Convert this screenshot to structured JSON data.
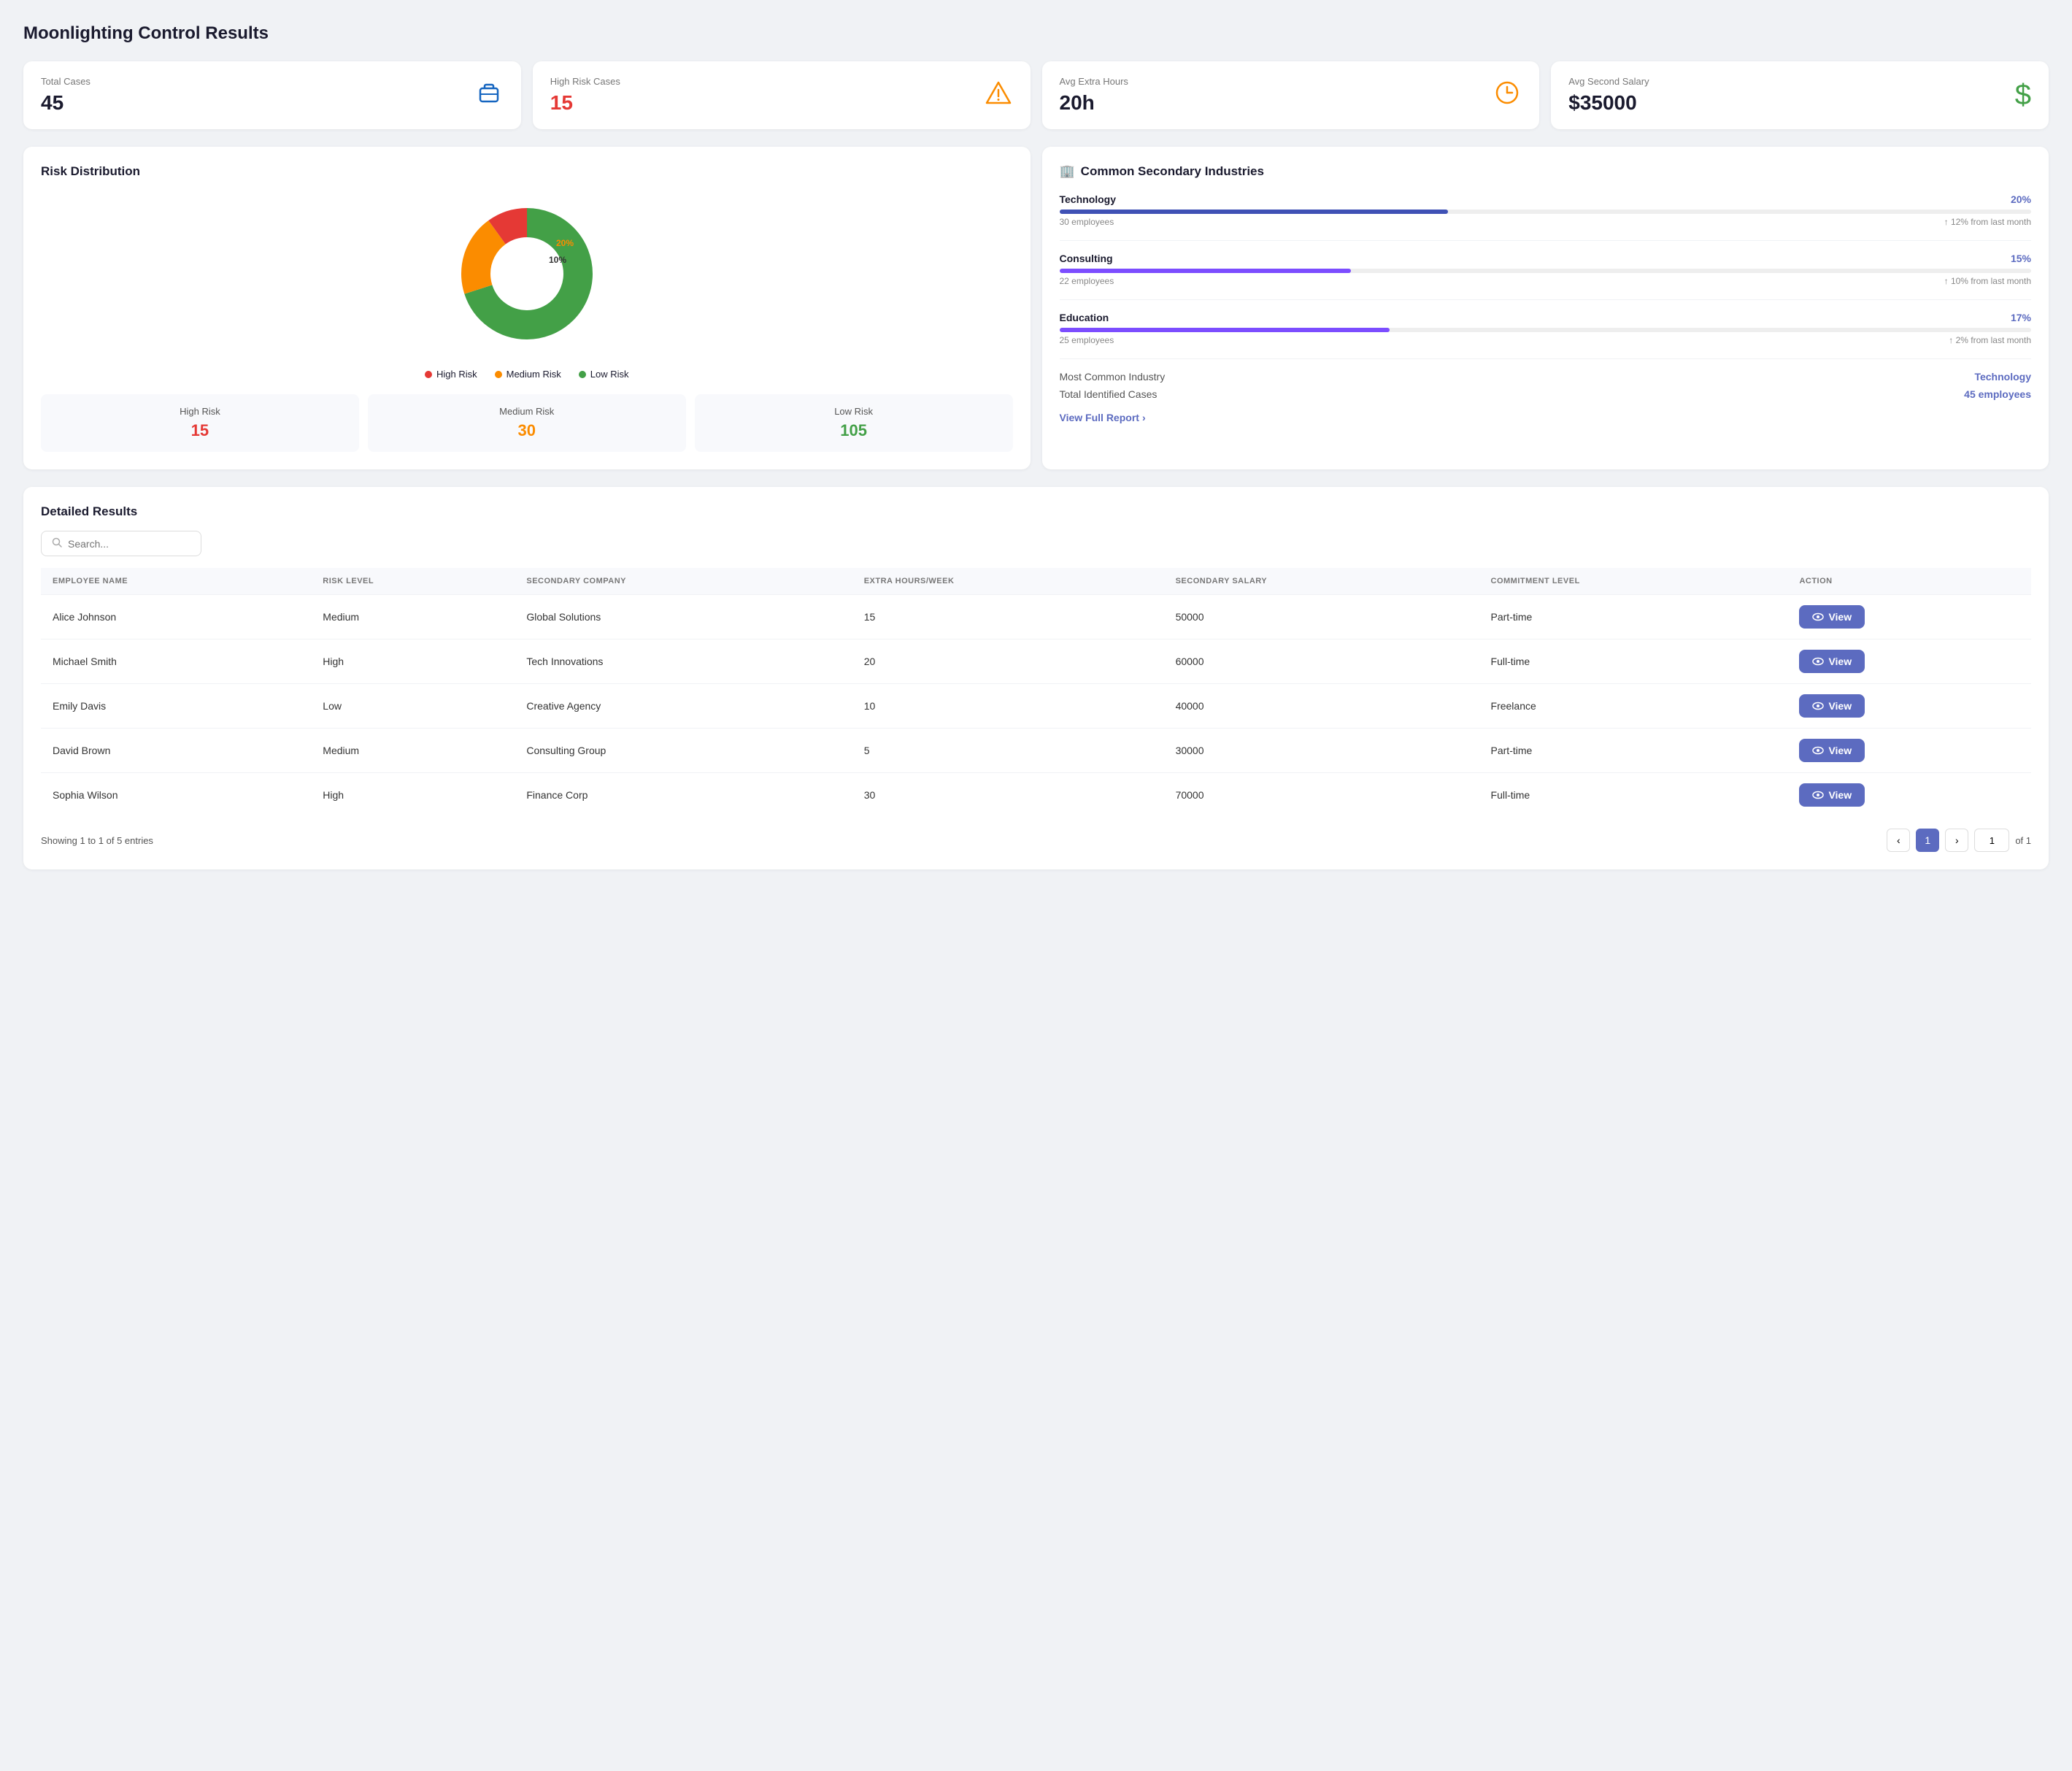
{
  "page": {
    "title": "Moonlighting Control Results"
  },
  "stats": [
    {
      "id": "total-cases",
      "label": "Total Cases",
      "value": "45",
      "value_color": "normal",
      "icon": "💼",
      "icon_color": "#1565c0"
    },
    {
      "id": "high-risk",
      "label": "High Risk Cases",
      "value": "15",
      "value_color": "red",
      "icon": "⚠️",
      "icon_color": "#fb8c00"
    },
    {
      "id": "avg-hours",
      "label": "Avg Extra Hours",
      "value": "20h",
      "value_color": "normal",
      "icon": "🕐",
      "icon_color": "#fb8c00"
    },
    {
      "id": "avg-salary",
      "label": "Avg Second Salary",
      "value": "$35000",
      "value_color": "normal",
      "icon": "$",
      "icon_color": "#43a047"
    }
  ],
  "risk_distribution": {
    "title": "Risk Distribution",
    "segments": [
      {
        "label": "High Risk",
        "pct": 10,
        "color": "#e53935",
        "start": 0
      },
      {
        "label": "Medium Risk",
        "pct": 20,
        "color": "#fb8c00",
        "start": 10
      },
      {
        "label": "Low Risk",
        "pct": 70,
        "color": "#43a047",
        "start": 30
      }
    ],
    "labels": {
      "high_risk": "High Risk",
      "medium_risk": "Medium Risk",
      "low_risk": "Low Risk"
    },
    "stats": [
      {
        "label": "High Risk",
        "value": "15",
        "color_class": "red"
      },
      {
        "label": "Medium Risk",
        "value": "30",
        "color_class": "orange"
      },
      {
        "label": "Low Risk",
        "value": "105",
        "color_class": "green"
      }
    ]
  },
  "industries": {
    "title": "Common Secondary Industries",
    "icon": "🏢",
    "items": [
      {
        "name": "Technology",
        "pct": "20%",
        "pct_num": 20,
        "bar_color": "#3f51b5",
        "employees": "30 employees",
        "trend": "↑ 12% from last month"
      },
      {
        "name": "Consulting",
        "pct": "15%",
        "pct_num": 15,
        "bar_color": "#7c4dff",
        "employees": "22 employees",
        "trend": "↑ 10% from last month"
      },
      {
        "name": "Education",
        "pct": "17%",
        "pct_num": 17,
        "bar_color": "#7c4dff",
        "employees": "25 employees",
        "trend": "↑ 2% from last month"
      }
    ],
    "summary": [
      {
        "label": "Most Common Industry",
        "value": "Technology"
      },
      {
        "label": "Total Identified Cases",
        "value": "45 employees"
      }
    ],
    "view_full_report": "View Full Report"
  },
  "detailed": {
    "title": "Detailed Results",
    "search_placeholder": "Search...",
    "columns": [
      "EMPLOYEE NAME",
      "RISK LEVEL",
      "SECONDARY COMPANY",
      "EXTRA HOURS/WEEK",
      "SECONDARY SALARY",
      "COMMITMENT LEVEL",
      "ACTION"
    ],
    "rows": [
      {
        "name": "Alice Johnson",
        "risk": "Medium",
        "company": "Global Solutions",
        "hours": "15",
        "salary": "50000",
        "commitment": "Part-time"
      },
      {
        "name": "Michael Smith",
        "risk": "High",
        "company": "Tech Innovations",
        "hours": "20",
        "salary": "60000",
        "commitment": "Full-time"
      },
      {
        "name": "Emily Davis",
        "risk": "Low",
        "company": "Creative Agency",
        "hours": "10",
        "salary": "40000",
        "commitment": "Freelance"
      },
      {
        "name": "David Brown",
        "risk": "Medium",
        "company": "Consulting Group",
        "hours": "5",
        "salary": "30000",
        "commitment": "Part-time"
      },
      {
        "name": "Sophia Wilson",
        "risk": "High",
        "company": "Finance Corp",
        "hours": "30",
        "salary": "70000",
        "commitment": "Full-time"
      }
    ],
    "action_label": "View",
    "pagination": {
      "showing": "Showing 1 to 1 of 5 entries",
      "current_page": 1,
      "total_pages": "1",
      "of_label": "of 1"
    }
  }
}
